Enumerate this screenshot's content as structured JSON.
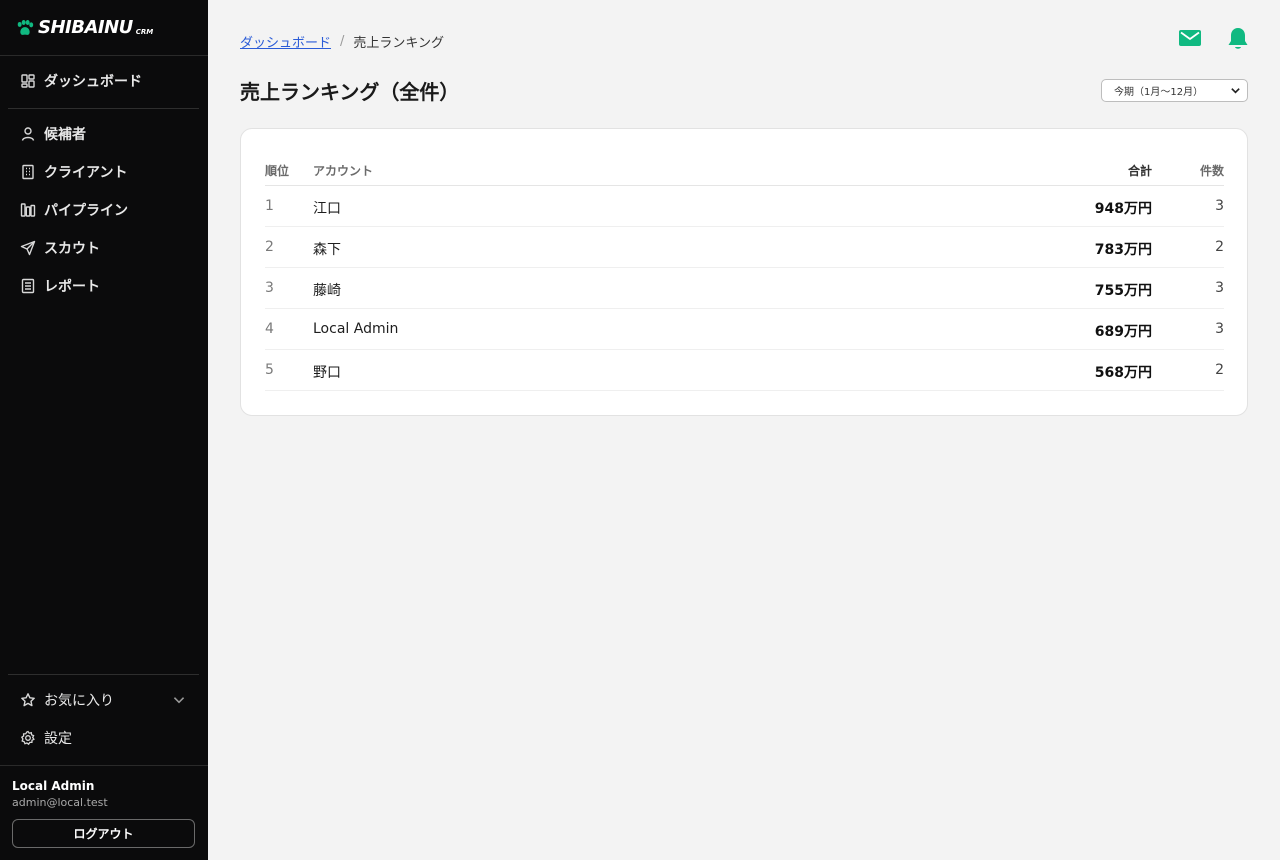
{
  "brand": {
    "name": "SHIBAINU",
    "sub": "CRM",
    "accent": "#10b981"
  },
  "sidebar": {
    "dashboard": "ダッシュボード",
    "items": [
      {
        "label": "候補者",
        "icon": "person-icon"
      },
      {
        "label": "クライアント",
        "icon": "building-icon"
      },
      {
        "label": "パイプライン",
        "icon": "pipeline-icon"
      },
      {
        "label": "スカウト",
        "icon": "send-icon"
      },
      {
        "label": "レポート",
        "icon": "report-icon"
      }
    ],
    "favorites": "お気に入り",
    "settings": "設定"
  },
  "user": {
    "name": "Local Admin",
    "email": "admin@local.test",
    "logout": "ログアウト"
  },
  "breadcrumb": {
    "parent": "ダッシュボード",
    "separator": "/",
    "current": "売上ランキング"
  },
  "page": {
    "title": "売上ランキング（全件）"
  },
  "period": {
    "selected": "今期（1月〜12月）"
  },
  "table": {
    "headers": {
      "rank": "順位",
      "account": "アカウント",
      "total": "合計",
      "count": "件数"
    },
    "rows": [
      {
        "rank": "1",
        "account": "江口",
        "total": "948万円",
        "count": "3"
      },
      {
        "rank": "2",
        "account": "森下",
        "total": "783万円",
        "count": "2"
      },
      {
        "rank": "3",
        "account": "藤崎",
        "total": "755万円",
        "count": "3"
      },
      {
        "rank": "4",
        "account": "Local Admin",
        "total": "689万円",
        "count": "3"
      },
      {
        "rank": "5",
        "account": "野口",
        "total": "568万円",
        "count": "2"
      }
    ]
  },
  "colors": {
    "sidebar_bg": "#0b0b0c",
    "accent": "#10b981",
    "link": "#2a5bd7",
    "page_bg": "#f3f3f3"
  }
}
